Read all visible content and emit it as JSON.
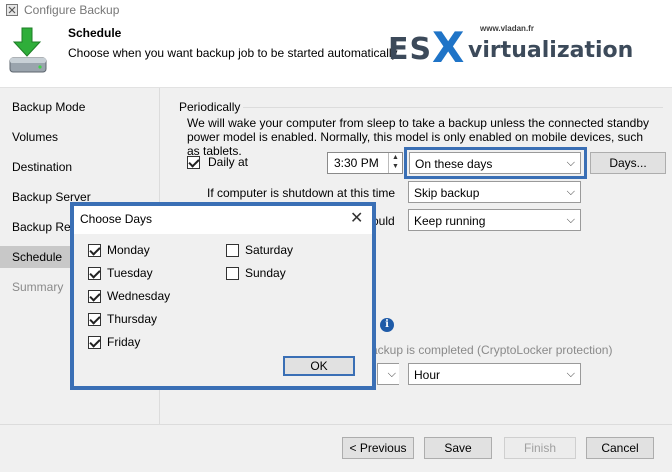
{
  "window": {
    "title": "Configure Backup"
  },
  "header": {
    "title": "Schedule",
    "subtitle": "Choose when you want backup job to be started automatically.",
    "logo": {
      "site": "www.vladan.fr",
      "es": "ES",
      "x": "X",
      "word": "virtualization"
    }
  },
  "sidebar": {
    "items": [
      {
        "label": "Backup Mode",
        "state": "normal"
      },
      {
        "label": "Volumes",
        "state": "normal"
      },
      {
        "label": "Destination",
        "state": "normal"
      },
      {
        "label": "Backup Server",
        "state": "normal"
      },
      {
        "label": "Backup Rep",
        "state": "normal"
      },
      {
        "label": "Schedule",
        "state": "active"
      },
      {
        "label": "Summary",
        "state": "disabled"
      }
    ]
  },
  "schedule": {
    "group_label": "Periodically",
    "description": "We will wake your computer from sleep to take a backup unless the connected standby power model is enabled. Normally, this model is only enabled on mobile devices, such as tablets.",
    "daily_label": "Daily at",
    "daily_checked": true,
    "time_value": "3:30 PM",
    "days_mode": "On these days",
    "days_button": "Days...",
    "shutdown_label": "If computer is shutdown at this time",
    "shutdown_value": "Skip backup",
    "partial_label": "ould",
    "keep_running_value": "Keep running",
    "cryptolocker_label": "ackup is completed (CryptoLocker protection)",
    "interval_unit": "Hour"
  },
  "dialog": {
    "title": "Choose Days",
    "days_left": [
      {
        "label": "Monday",
        "checked": true
      },
      {
        "label": "Tuesday",
        "checked": true
      },
      {
        "label": "Wednesday",
        "checked": true
      },
      {
        "label": "Thursday",
        "checked": true
      },
      {
        "label": "Friday",
        "checked": true
      }
    ],
    "days_right": [
      {
        "label": "Saturday",
        "checked": false
      },
      {
        "label": "Sunday",
        "checked": false
      }
    ],
    "ok_label": "OK"
  },
  "footer": {
    "previous_label": "< Previous",
    "save_label": "Save",
    "finish_label": "Finish",
    "cancel_label": "Cancel"
  },
  "colors": {
    "highlight": "#3a6fb5",
    "logo_x": "#1f74c7",
    "active_nav": "#c8c8c8"
  }
}
